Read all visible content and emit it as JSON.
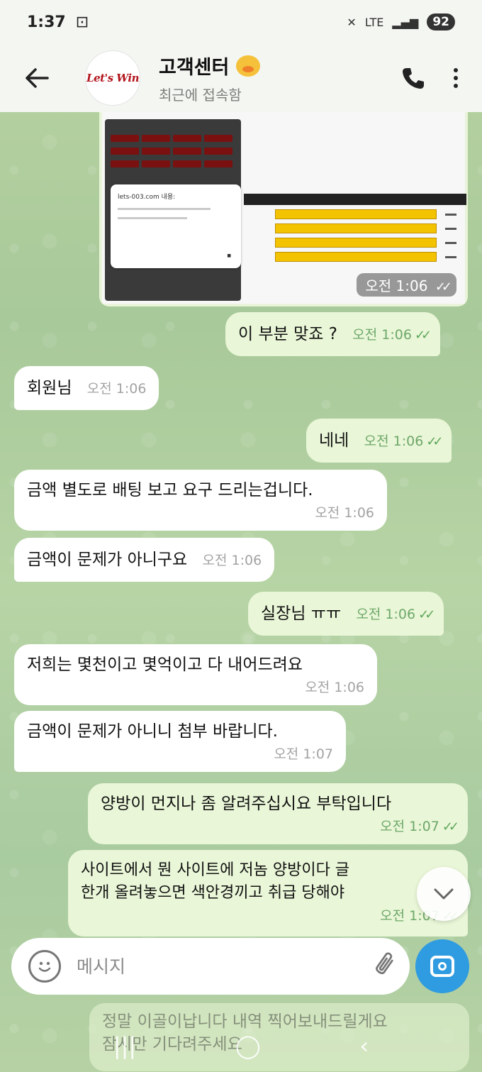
{
  "status": {
    "time": "1:37",
    "network": "LTE",
    "battery": "92"
  },
  "header": {
    "title": "고객센터",
    "subtitle": "최근에 접속함",
    "avatar_logo": "Let's Win"
  },
  "media": {
    "alert_title": "lets-003.com 내용:",
    "time": "오전 1:06"
  },
  "messages": [
    {
      "dir": "out",
      "text": "이 부분 맞죠 ?",
      "time": "오전 1:06"
    },
    {
      "dir": "in",
      "text": "회원님",
      "time": "오전 1:06"
    },
    {
      "dir": "out",
      "text": "네네",
      "time": "오전 1:06"
    },
    {
      "dir": "in",
      "text": "금액 별도로 배팅 보고 요구 드리는겁니다.",
      "time": "오전 1:06"
    },
    {
      "dir": "in",
      "text": "금액이 문제가 아니구요",
      "time": "오전 1:06"
    },
    {
      "dir": "out",
      "text": "실장님 ㅠㅠ",
      "time": "오전 1:06"
    },
    {
      "dir": "in",
      "text": "저희는 몇천이고 몇억이고 다 내어드려요",
      "time": "오전 1:06"
    },
    {
      "dir": "in",
      "text": "금액이 문제가 아니니 첨부 바랍니다.",
      "time": "오전 1:07"
    },
    {
      "dir": "out",
      "text": "양방이 먼지나 좀 알려주십시요 부탁입니다",
      "time": "오전 1:07"
    },
    {
      "dir": "out",
      "text_line1": "사이트에서 뭔 사이트에 저놈 양방이다 글",
      "text_line2": "한개 올려놓으면 색안경끼고 취급 당해야",
      "time": "오전 1:07"
    }
  ],
  "faded_message": {
    "line1": "정말 이골이납니다 내역 찍어보내드릴게요",
    "line2": "잠시만 기다려주세요"
  },
  "input": {
    "placeholder": "메시지"
  }
}
